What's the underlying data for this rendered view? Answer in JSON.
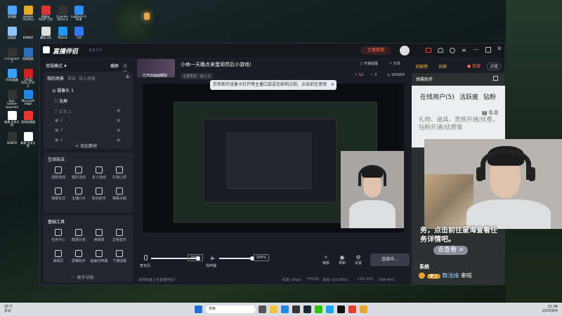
{
  "desktop": {
    "icons": [
      {
        "label": "此电脑",
        "color": "#4da3ff"
      },
      {
        "label": "Google Chrome",
        "color": "#e8a82b"
      },
      {
        "label": "网易云 RLUX 工作",
        "color": "#d33"
      },
      {
        "label": "Counter-Strike 2",
        "color": "#333"
      },
      {
        "label": "Logitech G HUB",
        "color": "#2d8cff"
      },
      {
        "label": "回收站",
        "color": "#8cc4ff"
      },
      {
        "label": "KANAVI",
        "color": "#222"
      },
      {
        "label": "腾讯 QQ",
        "color": "#ddd"
      },
      {
        "label": "ToDesk",
        "color": "#2196f3"
      },
      {
        "label": "飞书",
        "color": "#3377ff"
      },
      {
        "label": "L-Connect 3",
        "color": "#333"
      },
      {
        "label": "控制面板",
        "color": "#2c6fc4"
      },
      {
        "label": "PUBG BATTLEGR...",
        "color": "#e7a23a"
      },
      {
        "label": "Steam",
        "color": "#1b2838"
      },
      {
        "label": "QQ音乐",
        "color": "#f6c81d"
      },
      {
        "label": "UU加速器",
        "color": "#3aa0ff"
      },
      {
        "label": "CPUID ROG CPU-Z",
        "color": "#c22"
      },
      {
        "label": "WPS Office",
        "color": "#d32"
      },
      {
        "label": "EPIC GAMES",
        "color": "#222"
      },
      {
        "label": "NVIDIA",
        "color": "#76b900"
      },
      {
        "label": "Epic Games Launcher",
        "color": "#333"
      },
      {
        "label": "Microsoft Edge",
        "color": "#1e88e5"
      },
      {
        "label": "新建 文本文档",
        "color": "#fff"
      },
      {
        "label": "网易云音乐",
        "color": "#d33"
      },
      {
        "label": "微信",
        "color": "#2dc100"
      },
      {
        "label": "新建 文本文档",
        "color": "#fff"
      },
      {
        "label": "游戏加速器",
        "color": "#e33"
      },
      {
        "label": "新建 文本文档",
        "color": "#fff"
      },
      {
        "label": "KANAVI",
        "color": "#222"
      },
      {
        "label": "新建 文本文档",
        "color": "#fff"
      },
      {
        "label": "SANFEI",
        "color": "#333"
      },
      {
        "label": "新建 文本文档",
        "color": "#fff"
      },
      {
        "label": "文件管理器",
        "color": "#f5c542"
      }
    ]
  },
  "taskbar": {
    "search_placeholder": "搜索",
    "weather_temp": "25°C",
    "weather_desc": "多云",
    "time": "21:06",
    "date": "2025/6/4"
  },
  "app": {
    "logo": "直播伴侣",
    "version": "6.5.7.4",
    "live_data_btn": "主播数据",
    "stats": {
      "coins": "贡献榜",
      "rank": "贡献",
      "hot": "热度",
      "details": "详情"
    },
    "mode_label": "常规模式",
    "orientation": {
      "landscape": "横屏",
      "portrait": "竖屏"
    },
    "scene_tabs": [
      "我的场景",
      "双击",
      "导入场景"
    ],
    "sources": [
      {
        "label": "摄像头 1"
      },
      {
        "label": "全屏"
      },
      {
        "label": "文本 2"
      },
      {
        "label": "2"
      },
      {
        "label": "3"
      },
      {
        "label": "4"
      }
    ],
    "add_source": "添加素材",
    "interact_title": "互动玩法",
    "interact_items": [
      "视频连线",
      "福利活动",
      "多人连线",
      "礼物心愿",
      "弹幕玩法",
      "主播口令",
      "粉丝助手",
      "弹幕点歌"
    ],
    "tools_title": "基础工具",
    "tools_items": [
      "任务中心",
      "数据分析",
      "读弹幕",
      "正版音乐",
      "弹幕页",
      "屏蔽助手",
      "画面切换器",
      "下播提醒"
    ],
    "more_features": "更多功能",
    "live_title": "小休一天晚点来蛋顽然后小游戏!",
    "replay_label": "已开启画面截取",
    "tag": "主要类型 · 极入王",
    "meta": {
      "share": "分享",
      "viewers": "12",
      "likes": "3",
      "fans": "165993",
      "chat_toggle": "开播提醒"
    },
    "tip": "您有新的设备卡打开等主播口袋语言影响过程，点击前往使用",
    "mic_label": "麦克风",
    "mic_value": "300%",
    "speaker_label": "扬声器",
    "speaker_value": "200%",
    "beauty": "美颜",
    "record": "录制",
    "settings": "设置",
    "live_btn": "连接中...",
    "status": {
      "hint": "如何快速上手直播伴侣?",
      "bitrate": "码率: 0kb/s",
      "fps": "FPS:60",
      "drop": "丢帧: 0(0.00%)",
      "cpu": "CPU:31%",
      "mem": "内存:44%"
    }
  },
  "chat": {
    "header": "弹幕助手",
    "tabs": [
      "在线用户(5)",
      "活跃度",
      "钻粉"
    ],
    "gift": "0.0",
    "notice": "礼物、道具、贵族开通/续费，钻粉开通/续费等",
    "message": "务，点击前往星海查看任务详情吧。",
    "go_btn": "去查看 >",
    "user_label": "来啦",
    "user_name": "舞浅靖",
    "user_level": "1",
    "section": "系统"
  },
  "colors": {
    "accent": "#e8402b",
    "window": "#1a1c25",
    "panel": "#23262f"
  }
}
